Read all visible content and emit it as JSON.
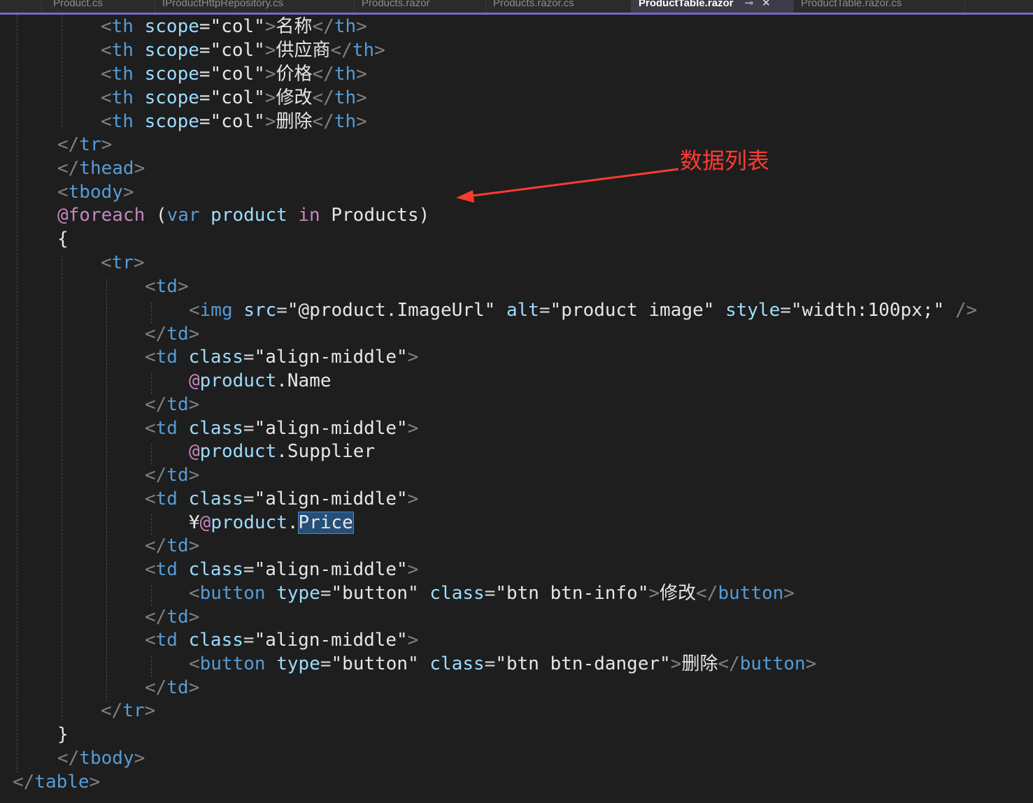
{
  "tabs": [
    {
      "label": "Product.cs"
    },
    {
      "label": "IProductHttpRepository.cs"
    },
    {
      "label": "Products.razor"
    },
    {
      "label": "Products.razor.cs"
    },
    {
      "label": "ProductTable.razor",
      "active": true,
      "pin": "⊸",
      "close": "✕"
    },
    {
      "label": "ProductTable.razor.cs"
    }
  ],
  "code": {
    "l1": {
      "open": "<",
      "tag": "th",
      "attr": "scope",
      "eq": "=",
      "val": "\"col\"",
      "close": ">",
      "text": "名称",
      "end_open": "</",
      "end_tag": "th",
      "end_close": ">"
    },
    "l2": {
      "open": "<",
      "tag": "th",
      "attr": "scope",
      "eq": "=",
      "val": "\"col\"",
      "close": ">",
      "text": "供应商",
      "end_open": "</",
      "end_tag": "th",
      "end_close": ">"
    },
    "l3": {
      "open": "<",
      "tag": "th",
      "attr": "scope",
      "eq": "=",
      "val": "\"col\"",
      "close": ">",
      "text": "价格",
      "end_open": "</",
      "end_tag": "th",
      "end_close": ">"
    },
    "l4": {
      "open": "<",
      "tag": "th",
      "attr": "scope",
      "eq": "=",
      "val": "\"col\"",
      "close": ">",
      "text": "修改",
      "end_open": "</",
      "end_tag": "th",
      "end_close": ">"
    },
    "l5": {
      "open": "<",
      "tag": "th",
      "attr": "scope",
      "eq": "=",
      "val": "\"col\"",
      "close": ">",
      "text": "删除",
      "end_open": "</",
      "end_tag": "th",
      "end_close": ">"
    },
    "l6": {
      "open": "</",
      "tag": "tr",
      "close": ">"
    },
    "l7": {
      "open": "</",
      "tag": "thead",
      "close": ">"
    },
    "l8": {
      "open": "<",
      "tag": "tbody",
      "close": ">"
    },
    "l9": {
      "at": "@",
      "kw1": "foreach",
      "p1": " (",
      "kw2": "var",
      "sp1": " ",
      "v1": "product",
      "sp2": " ",
      "kw3": "in",
      "sp3": " ",
      "v2": "Products",
      "p2": ")"
    },
    "l10": {
      "text": "{"
    },
    "l11": {
      "open": "<",
      "tag": "tr",
      "close": ">"
    },
    "l12": {
      "open": "<",
      "tag": "td",
      "close": ">"
    },
    "l13": {
      "open": "<",
      "tag": "img",
      "a1": "src",
      "v1": "\"@product.ImageUrl\"",
      "a2": "alt",
      "v2": "\"product image\"",
      "a3": "style",
      "v3": "\"width:100px;\"",
      "close": " />"
    },
    "l14": {
      "open": "</",
      "tag": "td",
      "close": ">"
    },
    "l15": {
      "open": "<",
      "tag": "td",
      "attr": "class",
      "val": "\"align-middle\"",
      "close": ">"
    },
    "l16": {
      "at": "@",
      "obj": "product",
      "dot": ".",
      "prop": "Name"
    },
    "l17": {
      "open": "</",
      "tag": "td",
      "close": ">"
    },
    "l18": {
      "open": "<",
      "tag": "td",
      "attr": "class",
      "val": "\"align-middle\"",
      "close": ">"
    },
    "l19": {
      "at": "@",
      "obj": "product",
      "dot": ".",
      "prop": "Supplier"
    },
    "l20": {
      "open": "</",
      "tag": "td",
      "close": ">"
    },
    "l21": {
      "open": "<",
      "tag": "td",
      "attr": "class",
      "val": "\"align-middle\"",
      "close": ">"
    },
    "l22": {
      "yen": "¥",
      "at": "@",
      "obj": "product",
      "dot": ".",
      "prop": "Price"
    },
    "l23": {
      "open": "</",
      "tag": "td",
      "close": ">"
    },
    "l24": {
      "open": "<",
      "tag": "td",
      "attr": "class",
      "val": "\"align-middle\"",
      "close": ">"
    },
    "l25": {
      "open": "<",
      "tag": "button",
      "a1": "type",
      "v1": "\"button\"",
      "a2": "class",
      "v2": "\"btn btn-info\"",
      "close": ">",
      "text": "修改",
      "end_open": "</",
      "end_tag": "button",
      "end_close": ">"
    },
    "l26": {
      "open": "</",
      "tag": "td",
      "close": ">"
    },
    "l27": {
      "open": "<",
      "tag": "td",
      "attr": "class",
      "val": "\"align-middle\"",
      "close": ">"
    },
    "l28": {
      "open": "<",
      "tag": "button",
      "a1": "type",
      "v1": "\"button\"",
      "a2": "class",
      "v2": "\"btn btn-danger\"",
      "close": ">",
      "text": "删除",
      "end_open": "</",
      "end_tag": "button",
      "end_close": ">"
    },
    "l29": {
      "open": "</",
      "tag": "td",
      "close": ">"
    },
    "l30": {
      "open": "</",
      "tag": "tr",
      "close": ">"
    },
    "l31": {
      "text": "}"
    },
    "l32": {
      "open": "</",
      "tag": "tbody",
      "close": ">"
    },
    "l33": {
      "open": "</",
      "tag": "table",
      "close": ">"
    }
  },
  "annotation": {
    "text": "数据列表",
    "color": "#ff3b30"
  },
  "colors": {
    "background": "#1e1e1e",
    "tag": "#569cd6",
    "attribute": "#9cdcfe",
    "razor": "#c586c0",
    "accent": "#7b68c9"
  }
}
